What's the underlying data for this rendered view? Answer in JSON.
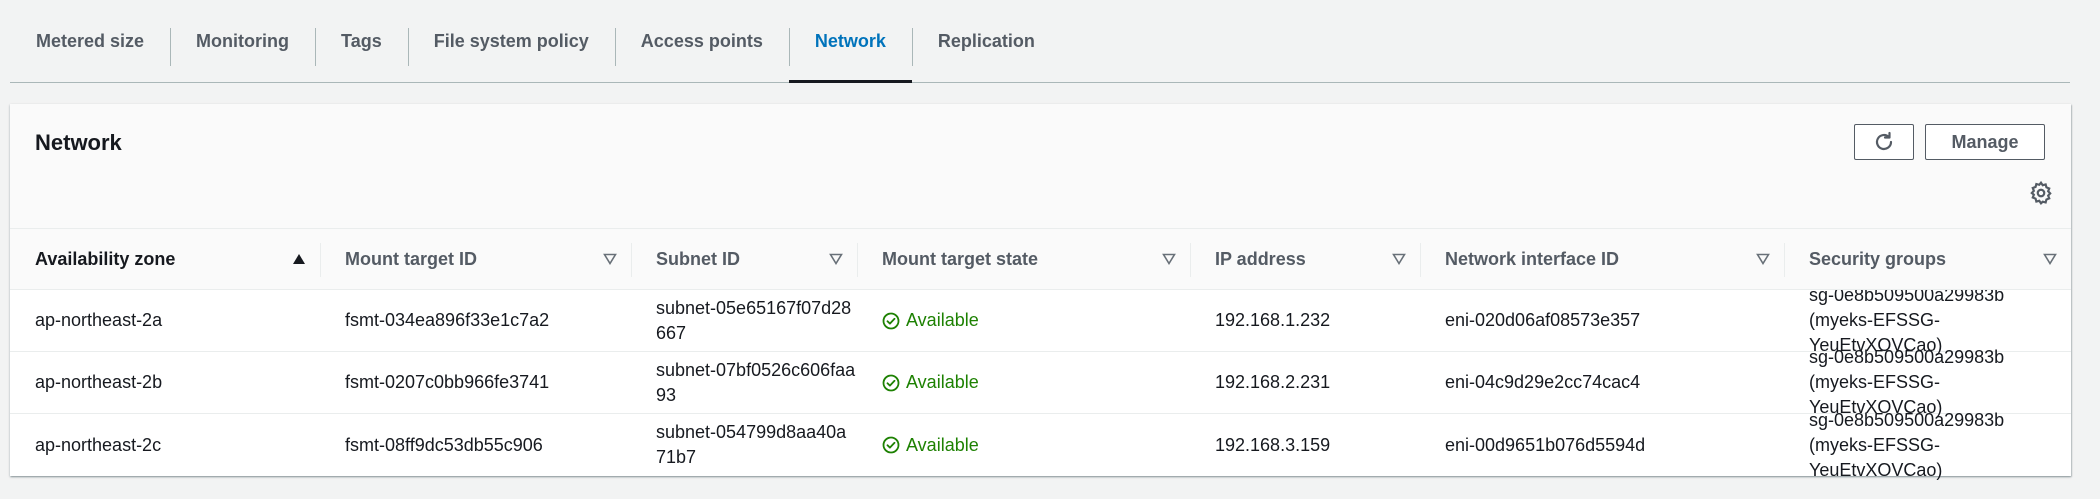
{
  "tabs": [
    {
      "label": "Metered size",
      "active": false
    },
    {
      "label": "Monitoring",
      "active": false
    },
    {
      "label": "Tags",
      "active": false
    },
    {
      "label": "File system policy",
      "active": false
    },
    {
      "label": "Access points",
      "active": false
    },
    {
      "label": "Network",
      "active": true
    },
    {
      "label": "Replication",
      "active": false
    }
  ],
  "panel": {
    "title": "Network",
    "manage_label": "Manage",
    "refresh_icon": "refresh-icon",
    "settings_icon": "gear-icon"
  },
  "table": {
    "columns": [
      {
        "label": "Availability zone",
        "sort": "ascending"
      },
      {
        "label": "Mount target ID",
        "sort": "none"
      },
      {
        "label": "Subnet ID",
        "sort": "none"
      },
      {
        "label": "Mount target state",
        "sort": "none"
      },
      {
        "label": "IP address",
        "sort": "none"
      },
      {
        "label": "Network interface ID",
        "sort": "none"
      },
      {
        "label": "Security groups",
        "sort": "none"
      }
    ],
    "rows": [
      {
        "az": "ap-northeast-2a",
        "mount_target_id": "fsmt-034ea896f33e1c7a2",
        "subnet_id": "subnet-05e65167f07d28667",
        "state": "Available",
        "ip": "192.168.1.232",
        "eni": "eni-020d06af08573e357",
        "sg_id": "sg-0e8b509500a29983b",
        "sg_name": "(myeks-EFSSG-YeuEtvXOVCao)"
      },
      {
        "az": "ap-northeast-2b",
        "mount_target_id": "fsmt-0207c0bb966fe3741",
        "subnet_id": "subnet-07bf0526c606faa93",
        "state": "Available",
        "ip": "192.168.2.231",
        "eni": "eni-04c9d29e2cc74cac4",
        "sg_id": "sg-0e8b509500a29983b",
        "sg_name": "(myeks-EFSSG-YeuEtvXOVCao)"
      },
      {
        "az": "ap-northeast-2c",
        "mount_target_id": "fsmt-08ff9dc53db55c906",
        "subnet_id": "subnet-054799d8aa40a71b7",
        "state": "Available",
        "ip": "192.168.3.159",
        "eni": "eni-00d9651b076d5594d",
        "sg_id": "sg-0e8b509500a29983b",
        "sg_name": "(myeks-EFSSG-YeuEtvXOVCao)"
      }
    ]
  },
  "colors": {
    "accent": "#0073bb",
    "success": "#1d8102",
    "text": "#16191f",
    "muted": "#545b64"
  }
}
